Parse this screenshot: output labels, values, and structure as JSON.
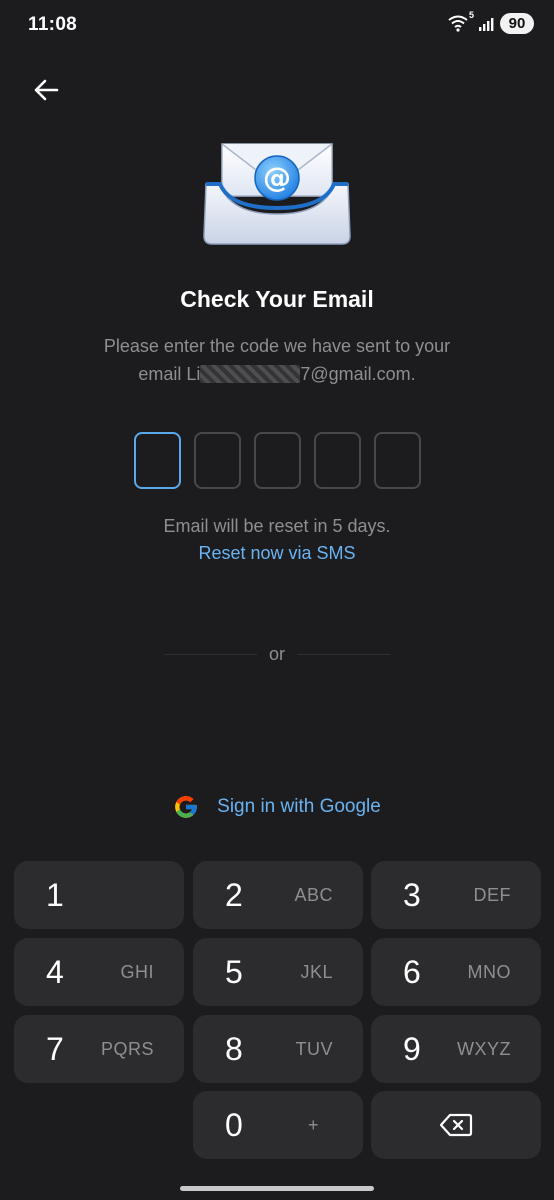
{
  "status_bar": {
    "time": "11:08",
    "network_badge": "5",
    "battery": "90"
  },
  "screen": {
    "title": "Check Your Email",
    "subtitle_line1": "Please enter the code we have sent to your",
    "email_prefix": "email Li",
    "email_suffix": "7@gmail.com.",
    "code_length": 5,
    "reset_info": "Email will be reset in 5 days.",
    "reset_link": "Reset now via SMS",
    "divider_text": "or",
    "google_button": "Sign in with Google"
  },
  "keypad": {
    "keys": [
      {
        "digit": "1",
        "letters": ""
      },
      {
        "digit": "2",
        "letters": "ABC"
      },
      {
        "digit": "3",
        "letters": "DEF"
      },
      {
        "digit": "4",
        "letters": "GHI"
      },
      {
        "digit": "5",
        "letters": "JKL"
      },
      {
        "digit": "6",
        "letters": "MNO"
      },
      {
        "digit": "7",
        "letters": "PQRS"
      },
      {
        "digit": "8",
        "letters": "TUV"
      },
      {
        "digit": "9",
        "letters": "WXYZ"
      },
      {
        "digit": "0",
        "letters": "+"
      }
    ]
  },
  "colors": {
    "background": "#1c1c1e",
    "accent": "#6ab3f3",
    "key_background": "#2c2c2e",
    "muted_text": "#8e8e93"
  }
}
